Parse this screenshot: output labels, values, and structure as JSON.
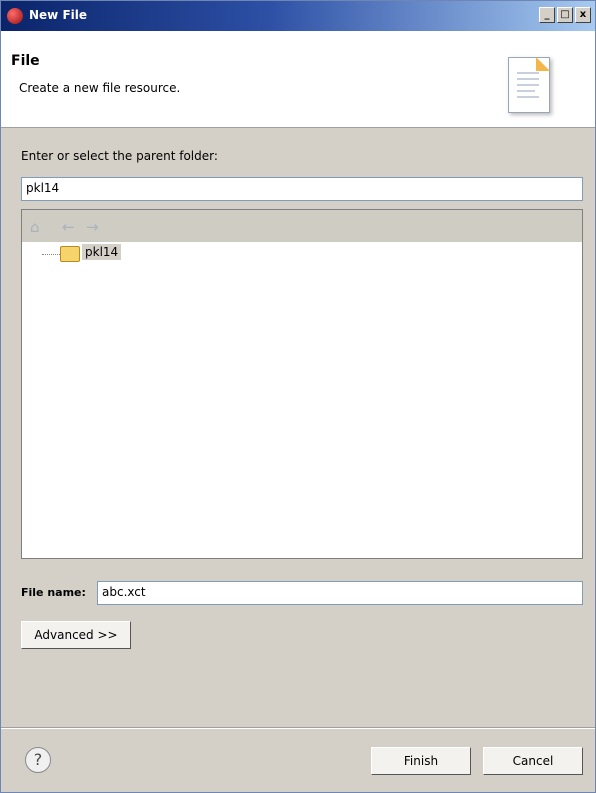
{
  "window": {
    "title": "New File",
    "minimize_glyph": "_",
    "maximize_glyph": "□",
    "close_glyph": "x"
  },
  "header": {
    "title": "File",
    "description": "Create a new file resource.",
    "icon": "new-file-document-icon"
  },
  "parent_folder": {
    "label": "Enter or select the parent folder:",
    "value": "pkl14"
  },
  "tree": {
    "toolbar_icons": [
      "home-icon",
      "back-arrow-icon",
      "forward-arrow-icon"
    ],
    "home_glyph": "⌂",
    "back_glyph": "←",
    "forward_glyph": "→",
    "items": [
      {
        "label": "pkl14",
        "icon": "open-folder-icon",
        "selected": true
      }
    ]
  },
  "file_name": {
    "label": "File name:",
    "value": "abc.xct"
  },
  "advanced_label": "Advanced >>",
  "footer": {
    "help_glyph": "?",
    "finish_label": "Finish",
    "cancel_label": "Cancel"
  }
}
